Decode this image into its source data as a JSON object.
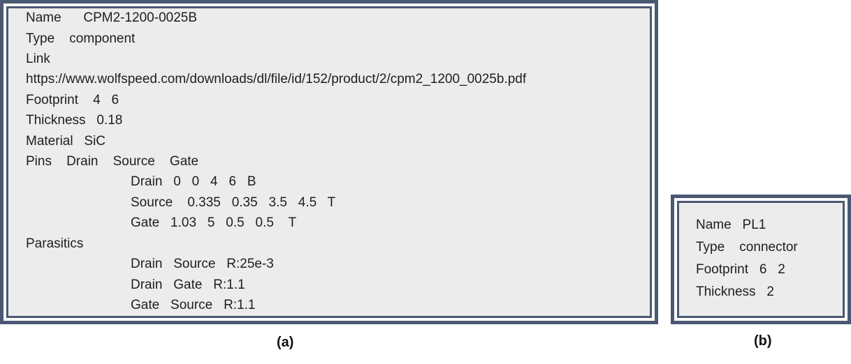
{
  "panel_a": {
    "caption": "(a)",
    "lines": [
      "Name      CPM2-1200-0025B",
      "Type    component",
      "Link",
      "https://www.wolfspeed.com/downloads/dl/file/id/152/product/2/cpm2_1200_0025b.pdf",
      "Footprint    4   6",
      "Thickness   0.18",
      "Material   SiC",
      "Pins    Drain    Source    Gate",
      "Drain   0   0   4   6   B",
      "Source    0.335   0.35   3.5   4.5   T",
      "Gate   1.03   5   0.5   0.5    T",
      "Parasitics",
      "Drain   Source   R:25e-3",
      "Drain   Gate   R:1.1",
      "Gate   Source   R:1.1"
    ]
  },
  "panel_b": {
    "caption": "(b)",
    "lines": [
      "Name   PL1",
      "Type    connector",
      "Footprint   6   2",
      "Thickness   2"
    ]
  }
}
